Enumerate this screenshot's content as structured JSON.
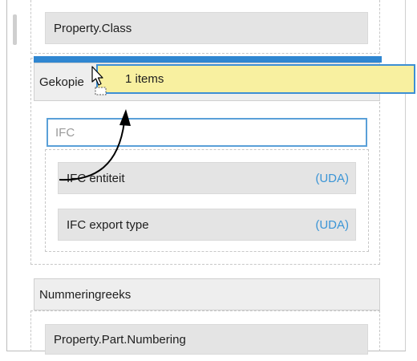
{
  "property_class_label": "Property.Class",
  "drop_group": {
    "label": "Gekopie"
  },
  "drag_tooltip": {
    "text": "1 items"
  },
  "ifc_group": {
    "header": "IFC",
    "items": [
      {
        "label": "IFC entiteit",
        "tag": "(UDA)"
      },
      {
        "label": "IFC export type",
        "tag": "(UDA)"
      }
    ]
  },
  "numbering_group": {
    "header": "Nummeringreeks",
    "items": [
      {
        "label": "Property.Part.Numbering"
      }
    ]
  },
  "colors": {
    "accent": "#2f86d1",
    "uda": "#3b95d6",
    "tooltip_bg": "#f8f0a0"
  },
  "icons": [
    "drag-cursor-icon",
    "drag-path-arrow-icon"
  ]
}
